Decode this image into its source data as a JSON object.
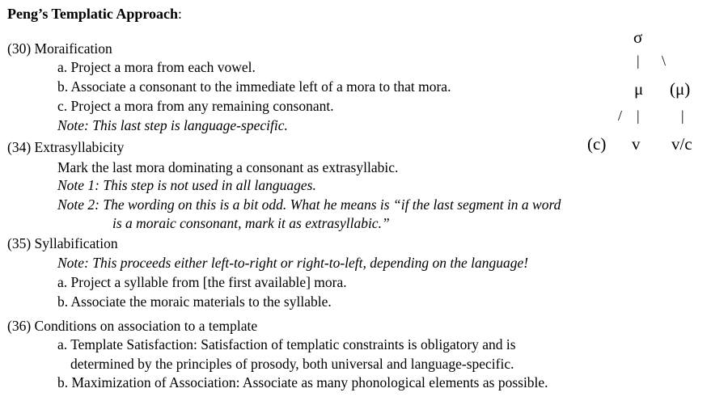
{
  "heading": {
    "bold": "Peng’s Templatic Approach",
    "colon": ":"
  },
  "sec30": {
    "title": "(30) Moraification",
    "a": "a. Project a mora from each vowel.",
    "b": "b. Associate a consonant to the immediate left of a mora to that mora.",
    "c": "c. Project a mora from any remaining consonant.",
    "note": "Note: This last step is language-specific."
  },
  "sec34": {
    "title": "(34) Extrasyllabicity",
    "main": "Mark the last mora dominating a consonant as extrasyllabic.",
    "note1": "Note 1: This step is not used in all languages.",
    "note2_l1": "Note 2: The wording on this is a bit odd. What he means is “if the last segment in a word",
    "note2_l2": "is a moraic consonant, mark it as extrasyllabic.”"
  },
  "sec35": {
    "title": "(35) Syllabification",
    "note": "Note: This proceeds either left-to-right or right-to-left, depending on the language!",
    "a": "a. Project a syllable from [the first available] mora.",
    "b": "b. Associate the moraic materials to the syllable."
  },
  "sec36": {
    "title": "(36) Conditions on association to a template",
    "a_l1": "a. Template Satisfaction: Satisfaction of templatic constraints is obligatory and is",
    "a_l2": "determined by the principles of prosody, both universal and language-specific.",
    "b": "b. Maximization of Association: Associate as many phonological elements as possible."
  },
  "tree": {
    "sigma": "σ",
    "mu": "μ",
    "mu_opt": "(μ)",
    "c_opt": "(c)",
    "v": "v",
    "vc": "v/c",
    "vbar": "|",
    "bslash": "\\",
    "slash": "/"
  }
}
